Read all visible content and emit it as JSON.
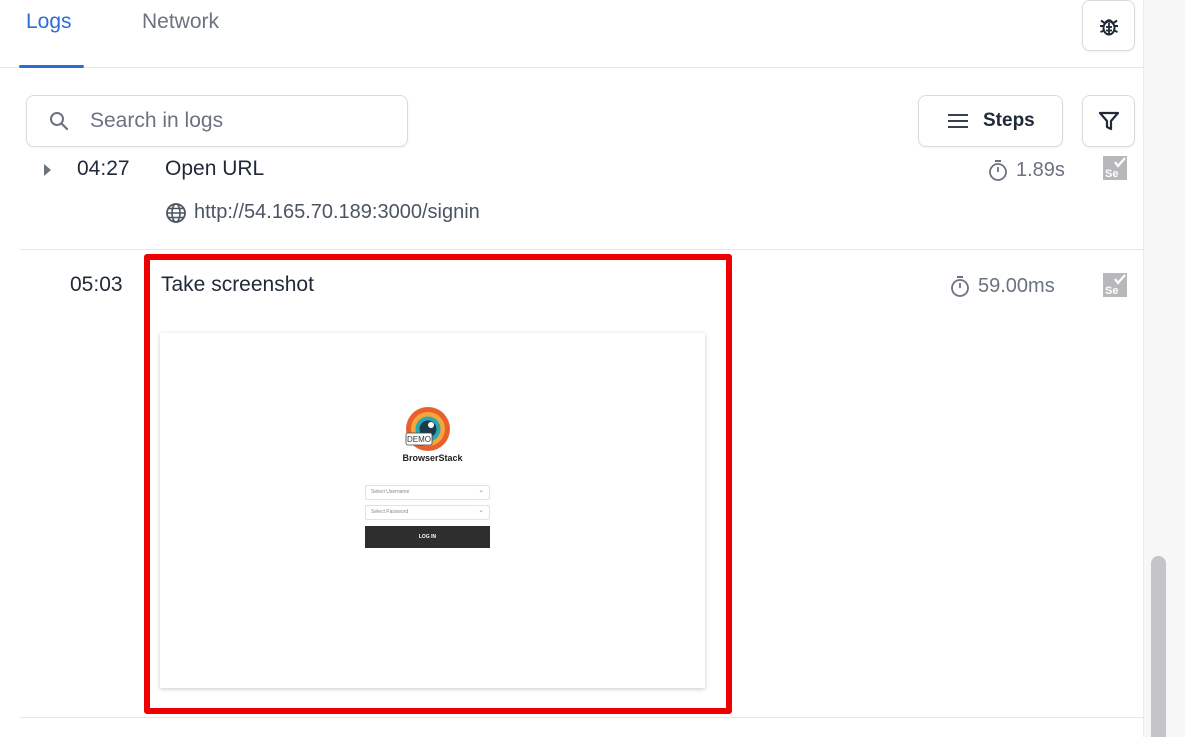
{
  "tabs": [
    {
      "label": "Logs",
      "active": true
    },
    {
      "label": "Network",
      "active": false
    }
  ],
  "toolbar": {
    "search_placeholder": "Search in logs",
    "steps_label": "Steps",
    "bug_icon": "bug-icon",
    "filter_icon": "filter-icon"
  },
  "logs": [
    {
      "time": "04:27",
      "title": "Open URL",
      "url": "http://54.165.70.189:3000/signin",
      "duration": "1.89s",
      "expandable": true,
      "source_icon": "selenium-icon"
    },
    {
      "time": "05:03",
      "title": "Take screenshot",
      "duration": "59.00ms",
      "expandable": false,
      "source_icon": "selenium-icon",
      "screenshot": {
        "logo_badge": "DEMO",
        "brand": "BrowserStack",
        "username_placeholder": "Select Username",
        "password_placeholder": "Select Password",
        "login_label": "LOG IN"
      }
    }
  ],
  "colors": {
    "accent": "#2b6cd8",
    "highlight": "#ee0000"
  }
}
